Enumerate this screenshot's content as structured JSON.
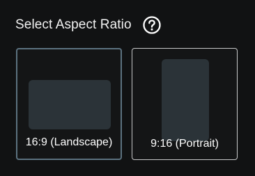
{
  "header": {
    "title": "Select Aspect Ratio",
    "help_icon": "question-circle-icon"
  },
  "options": [
    {
      "label": "16:9 (Landscape)",
      "selected": true
    },
    {
      "label": "9:16 (Portrait)",
      "selected": false
    }
  ],
  "colors": {
    "background": "#111213",
    "selected_border": "#5c7280",
    "unselected_border": "#c9cacb",
    "preview_fill": "#2b3338",
    "text": "#ffffff"
  }
}
